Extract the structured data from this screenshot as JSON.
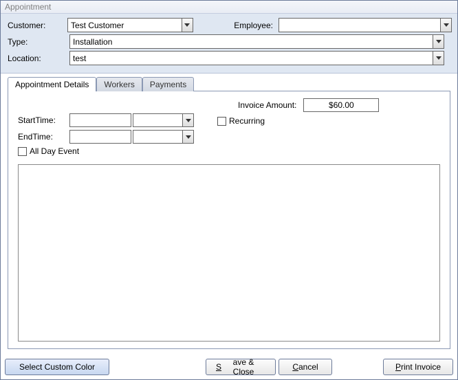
{
  "window": {
    "title": "Appointment"
  },
  "form": {
    "customer_label": "Customer:",
    "customer_value": "Test Customer",
    "employee_label": "Employee:",
    "employee_value": "",
    "type_label": "Type:",
    "type_value": "Installation",
    "location_label": "Location:",
    "location_value": "test"
  },
  "tabs": {
    "details": "Appointment Details",
    "workers": "Workers",
    "payments": "Payments"
  },
  "details": {
    "invoice_label": "Invoice Amount:",
    "invoice_value": "$60.00",
    "start_label": "StartTime:",
    "start_date": "",
    "start_time": "",
    "end_label": "EndTime:",
    "end_date": "",
    "end_time": "",
    "recurring_label": "Recurring",
    "allday_label": "All Day Event",
    "notes": ""
  },
  "buttons": {
    "color": "Select Custom Color",
    "save_prefix": "S",
    "save_rest": "ave & Close",
    "cancel_prefix": "C",
    "cancel_rest": "ancel",
    "print_prefix": "P",
    "print_rest": "rint Invoice"
  }
}
